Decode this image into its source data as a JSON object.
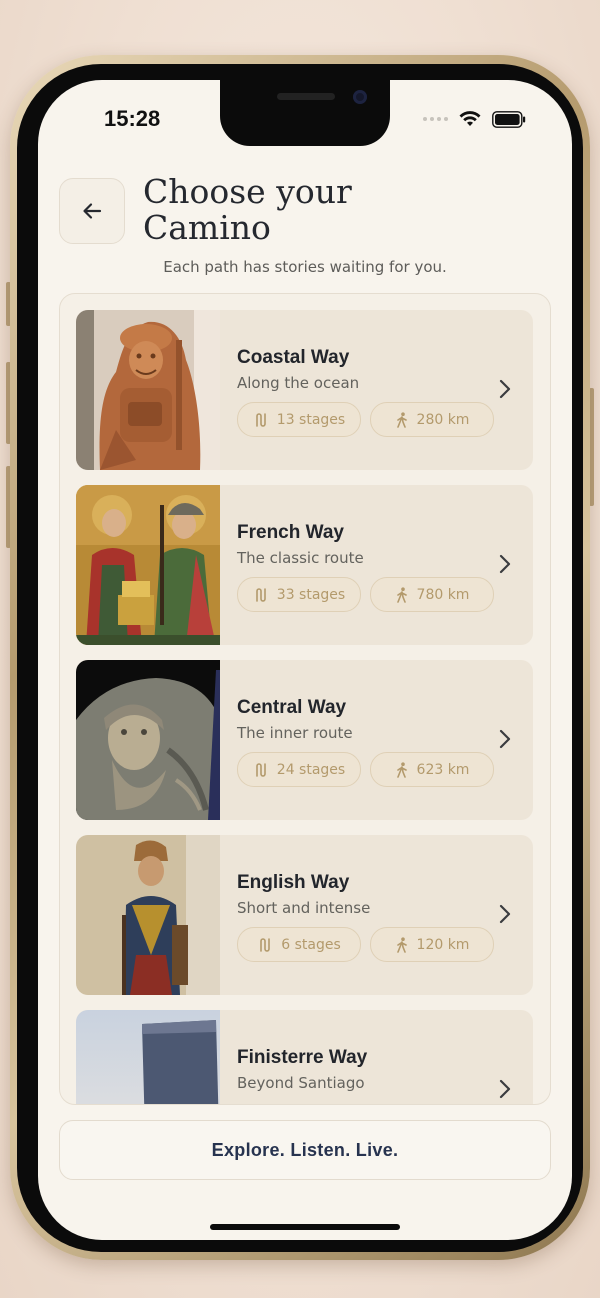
{
  "status_bar": {
    "time": "15:28"
  },
  "header": {
    "back_icon": "arrow-left-icon",
    "title": "Choose your Camino",
    "subtitle": "Each path has stories waiting for you."
  },
  "routes": [
    {
      "name": "Coastal Way",
      "description": "Along the ocean",
      "stages": "13 stages",
      "distance": "280 km",
      "image": "carved-wood-pilgrim-statue"
    },
    {
      "name": "French Way",
      "description": "The classic route",
      "stages": "33 stages",
      "distance": "780 km",
      "image": "painted-saints-altarpiece"
    },
    {
      "name": "Central Way",
      "description": "The inner route",
      "stages": "24 stages",
      "distance": "623 km",
      "image": "carved-stone-bearded-face"
    },
    {
      "name": "English Way",
      "description": "Short and intense",
      "stages": "6 stages",
      "distance": "120 km",
      "image": "painted-wooden-saint-figure"
    },
    {
      "name": "Finisterre Way",
      "description": "Beyond Santiago",
      "image": "sea-sky-sculpture"
    }
  ],
  "icons": {
    "stages": "route-icon",
    "distance": "walking-person-icon",
    "chevron": "chevron-right-icon"
  },
  "footer": {
    "tagline": "Explore. Listen. Live."
  },
  "colors": {
    "background": "#f8f4ed",
    "card": "#ede5d8",
    "accent": "#b39a6c",
    "footer_text": "#27334f"
  }
}
